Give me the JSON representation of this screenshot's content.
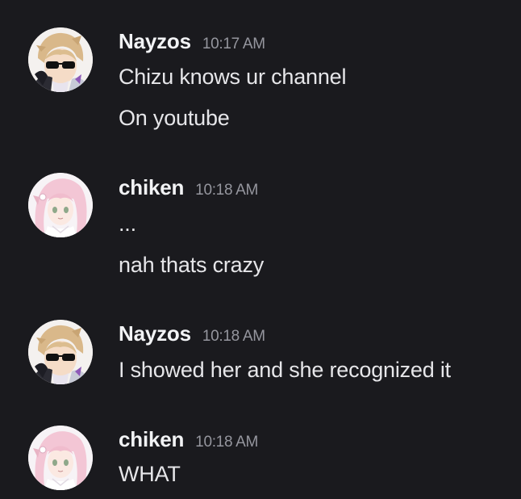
{
  "messages": [
    {
      "author": "Nayzos",
      "time": "10:17 AM",
      "avatar_icon": "sunglasses-anime-avatar-icon",
      "lines": [
        "Chizu knows ur channel",
        "On youtube"
      ]
    },
    {
      "author": "chiken",
      "time": "10:18 AM",
      "avatar_icon": "pink-hair-anime-avatar-icon",
      "lines": [
        "...",
        "nah thats crazy"
      ]
    },
    {
      "author": "Nayzos",
      "time": "10:18 AM",
      "avatar_icon": "sunglasses-anime-avatar-icon",
      "lines": [
        "I showed her and she recognized it"
      ]
    },
    {
      "author": "chiken",
      "time": "10:18 AM",
      "avatar_icon": "pink-hair-anime-avatar-icon",
      "lines": [
        "WHAT"
      ]
    }
  ],
  "colors": {
    "background": "#1a1a1e",
    "author": "#f2f3f5",
    "timestamp": "#95969e",
    "text": "#e6e6e9"
  }
}
